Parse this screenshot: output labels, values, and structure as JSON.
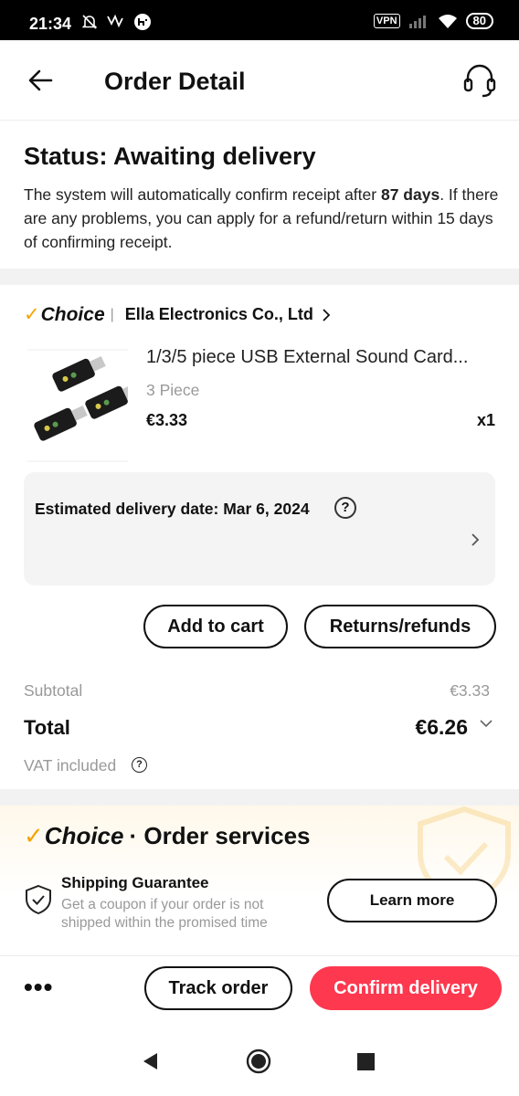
{
  "status_bar": {
    "time": "21:34",
    "vpn_label": "VPN",
    "battery": "80"
  },
  "header": {
    "title": "Order Detail"
  },
  "order_status": {
    "title": "Status: Awaiting delivery",
    "desc_before": "The system will automatically confirm receipt after ",
    "desc_days": "87 days",
    "desc_after": ". If there are any problems, you can apply for a refund/return within 15 days of confirming receipt."
  },
  "store": {
    "brand": "Choice",
    "name": "Ella Electronics Co., Ltd"
  },
  "product": {
    "title": "1/3/5 piece USB External Sound Card...",
    "variant": "3 Piece",
    "price": "€3.33",
    "quantity": "x1"
  },
  "delivery": {
    "text": "Estimated delivery date: Mar 6, 2024"
  },
  "actions": {
    "add_to_cart": "Add to cart",
    "returns": "Returns/refunds"
  },
  "summary": {
    "subtotal_label": "Subtotal",
    "subtotal_value": "€3.33",
    "total_label": "Total",
    "total_value": "€6.26",
    "vat_label": "VAT included"
  },
  "services": {
    "brand": "Choice",
    "title": "· Order services",
    "shipping_title": "Shipping Guarantee",
    "shipping_desc": "Get a coupon if your order is not shipped within the promised time",
    "learn_more": "Learn more"
  },
  "bottom_bar": {
    "more": "•••",
    "track_order": "Track order",
    "confirm_delivery": "Confirm delivery"
  },
  "colors": {
    "accent": "#fd384f",
    "choice_check": "#f5a300"
  }
}
